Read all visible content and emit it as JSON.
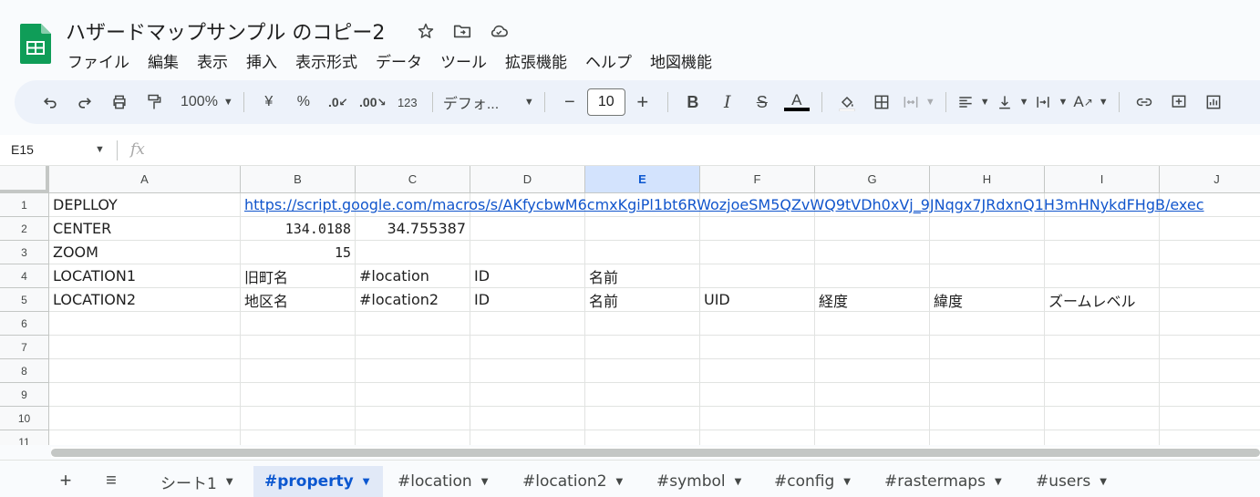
{
  "app": {
    "title": "ハザードマップサンプル のコピー2",
    "menu": [
      "ファイル",
      "編集",
      "表示",
      "挿入",
      "表示形式",
      "データ",
      "ツール",
      "拡張機能",
      "ヘルプ",
      "地図機能"
    ]
  },
  "toolbar": {
    "zoom": "100%",
    "currency": "¥",
    "percent": "%",
    "dec_decrease": ".0",
    "dec_increase": ".00",
    "format_123": "123",
    "font": "デフォ...",
    "font_size": "10",
    "minus": "−",
    "plus": "+"
  },
  "formula_bar": {
    "name_box": "E15",
    "fx": "fx"
  },
  "columns": [
    "A",
    "B",
    "C",
    "D",
    "E",
    "F",
    "G",
    "H",
    "I",
    "J"
  ],
  "selected_column": "E",
  "rows": [
    "1",
    "2",
    "3",
    "4",
    "5",
    "6",
    "7",
    "8",
    "9",
    "10",
    "11"
  ],
  "cells": {
    "A1": "DEPLLOY",
    "B1": "https://script.google.com/macros/s/AKfycbwM6cmxKgiPl1bt6RWozjoeSM5QZvWQ9tVDh0xVj_9JNqgx7JRdxnQ1H3mHNykdFHgB/exec",
    "A2": "CENTER",
    "B2": "134.0188",
    "C2": "34.755387",
    "A3": "ZOOM",
    "B3": "15",
    "A4": "LOCATION1",
    "B4": "旧町名",
    "C4": "#location",
    "D4": "ID",
    "E4": "名前",
    "A5": "LOCATION2",
    "B5": "地区名",
    "C5": "#location2",
    "D5": "ID",
    "E5": "名前",
    "F5": "UID",
    "G5": "経度",
    "H5": "緯度",
    "I5": "ズームレベル"
  },
  "sheets": [
    {
      "name": "シート1",
      "active": false
    },
    {
      "name": "#property",
      "active": true
    },
    {
      "name": "#location",
      "active": false
    },
    {
      "name": "#location2",
      "active": false
    },
    {
      "name": "#symbol",
      "active": false
    },
    {
      "name": "#config",
      "active": false
    },
    {
      "name": "#rastermaps",
      "active": false
    },
    {
      "name": "#users",
      "active": false
    }
  ],
  "colors": {
    "accent": "#0b57d0",
    "link": "#1155cc",
    "sheets_green": "#0f9d58"
  }
}
